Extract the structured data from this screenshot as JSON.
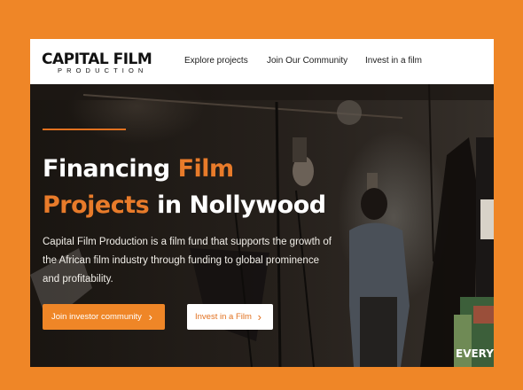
{
  "brand": {
    "logo_line1": "CAPITAL FILM",
    "logo_line2": "PRODUCTION"
  },
  "nav": {
    "items": [
      {
        "label": "Explore projects"
      },
      {
        "label": "Join Our Community"
      },
      {
        "label": "Invest in a film"
      }
    ]
  },
  "hero": {
    "title_part1": "Financing ",
    "title_part2": "Film",
    "title_part3": "Projects",
    "title_part4": " in Nollywood",
    "description": "Capital Film Production is a film fund that supports the growth of the African film industry through funding to global prominence and profitability.",
    "primary_button": "Join investor community",
    "secondary_button": "Invest in a Film",
    "chevron": "›",
    "poster_text": "EVERYTH"
  },
  "colors": {
    "page_background": "#ef8627",
    "accent": "#e87b2a",
    "nav_text": "#1c1c1c",
    "hero_text": "#ffffff"
  }
}
